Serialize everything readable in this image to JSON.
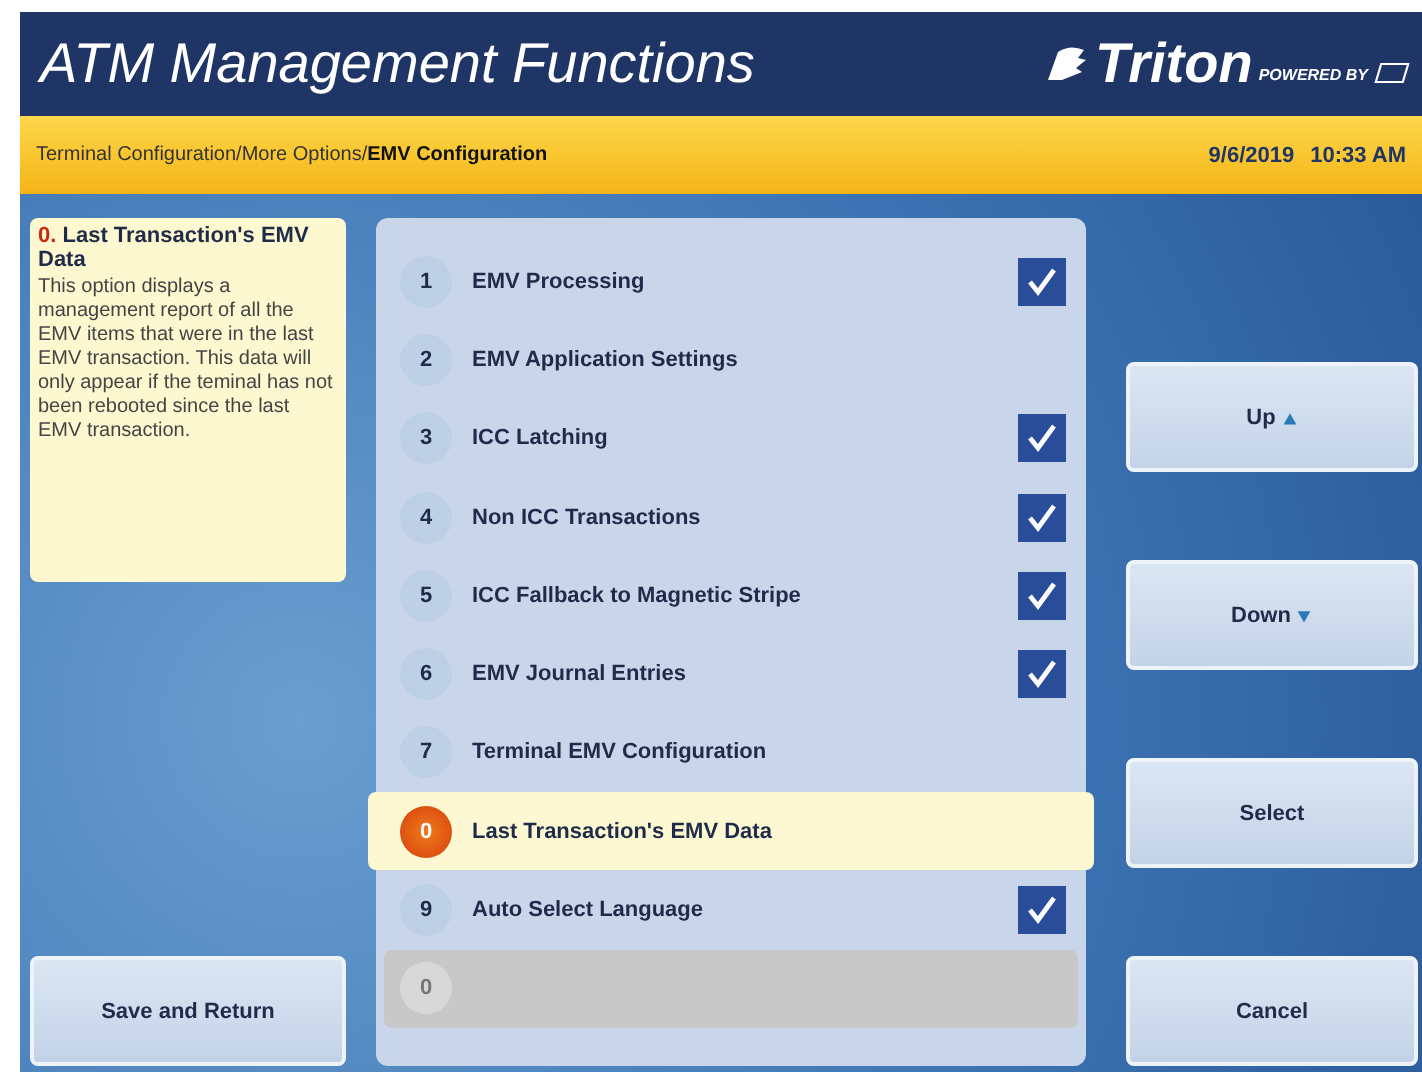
{
  "header": {
    "title": "ATM Management Functions",
    "brand": "Triton",
    "brand_tagline": "POWERED BY"
  },
  "breadcrumb": {
    "path": "Terminal Configuration/More Options/",
    "current": "EMV Configuration",
    "date": "9/6/2019",
    "time": "10:33 AM"
  },
  "help": {
    "number": "0.",
    "title": "Last Transaction's EMV Data",
    "text": "This option displays a management report of all the EMV items that were in the last EMV transaction. This data will only appear if the teminal has not been rebooted since the last EMV transaction."
  },
  "items": [
    {
      "number": "1",
      "label": "EMV Processing",
      "checked": true,
      "selected": false,
      "disabled": false
    },
    {
      "number": "2",
      "label": "EMV Application Settings",
      "checked": false,
      "selected": false,
      "disabled": false
    },
    {
      "number": "3",
      "label": "ICC Latching",
      "checked": true,
      "selected": false,
      "disabled": false
    },
    {
      "number": "4",
      "label": "Non ICC Transactions",
      "checked": true,
      "selected": false,
      "disabled": false
    },
    {
      "number": "5",
      "label": "ICC Fallback to Magnetic Stripe",
      "checked": true,
      "selected": false,
      "disabled": false
    },
    {
      "number": "6",
      "label": "EMV Journal Entries",
      "checked": true,
      "selected": false,
      "disabled": false
    },
    {
      "number": "7",
      "label": "Terminal EMV Configuration",
      "checked": false,
      "selected": false,
      "disabled": false
    },
    {
      "number": "0",
      "label": "Last Transaction's EMV Data",
      "checked": false,
      "selected": true,
      "disabled": false
    },
    {
      "number": "9",
      "label": "Auto Select Language",
      "checked": true,
      "selected": false,
      "disabled": false
    },
    {
      "number": "0",
      "checked": false,
      "selected": false,
      "disabled": true
    }
  ],
  "left_button": "Save and Return",
  "right_buttons": [
    {
      "label": "Up",
      "kind": "up"
    },
    {
      "label": "Down",
      "kind": "down"
    },
    {
      "label": "Select",
      "kind": "plain"
    },
    {
      "label": "Cancel",
      "kind": "plain"
    }
  ]
}
